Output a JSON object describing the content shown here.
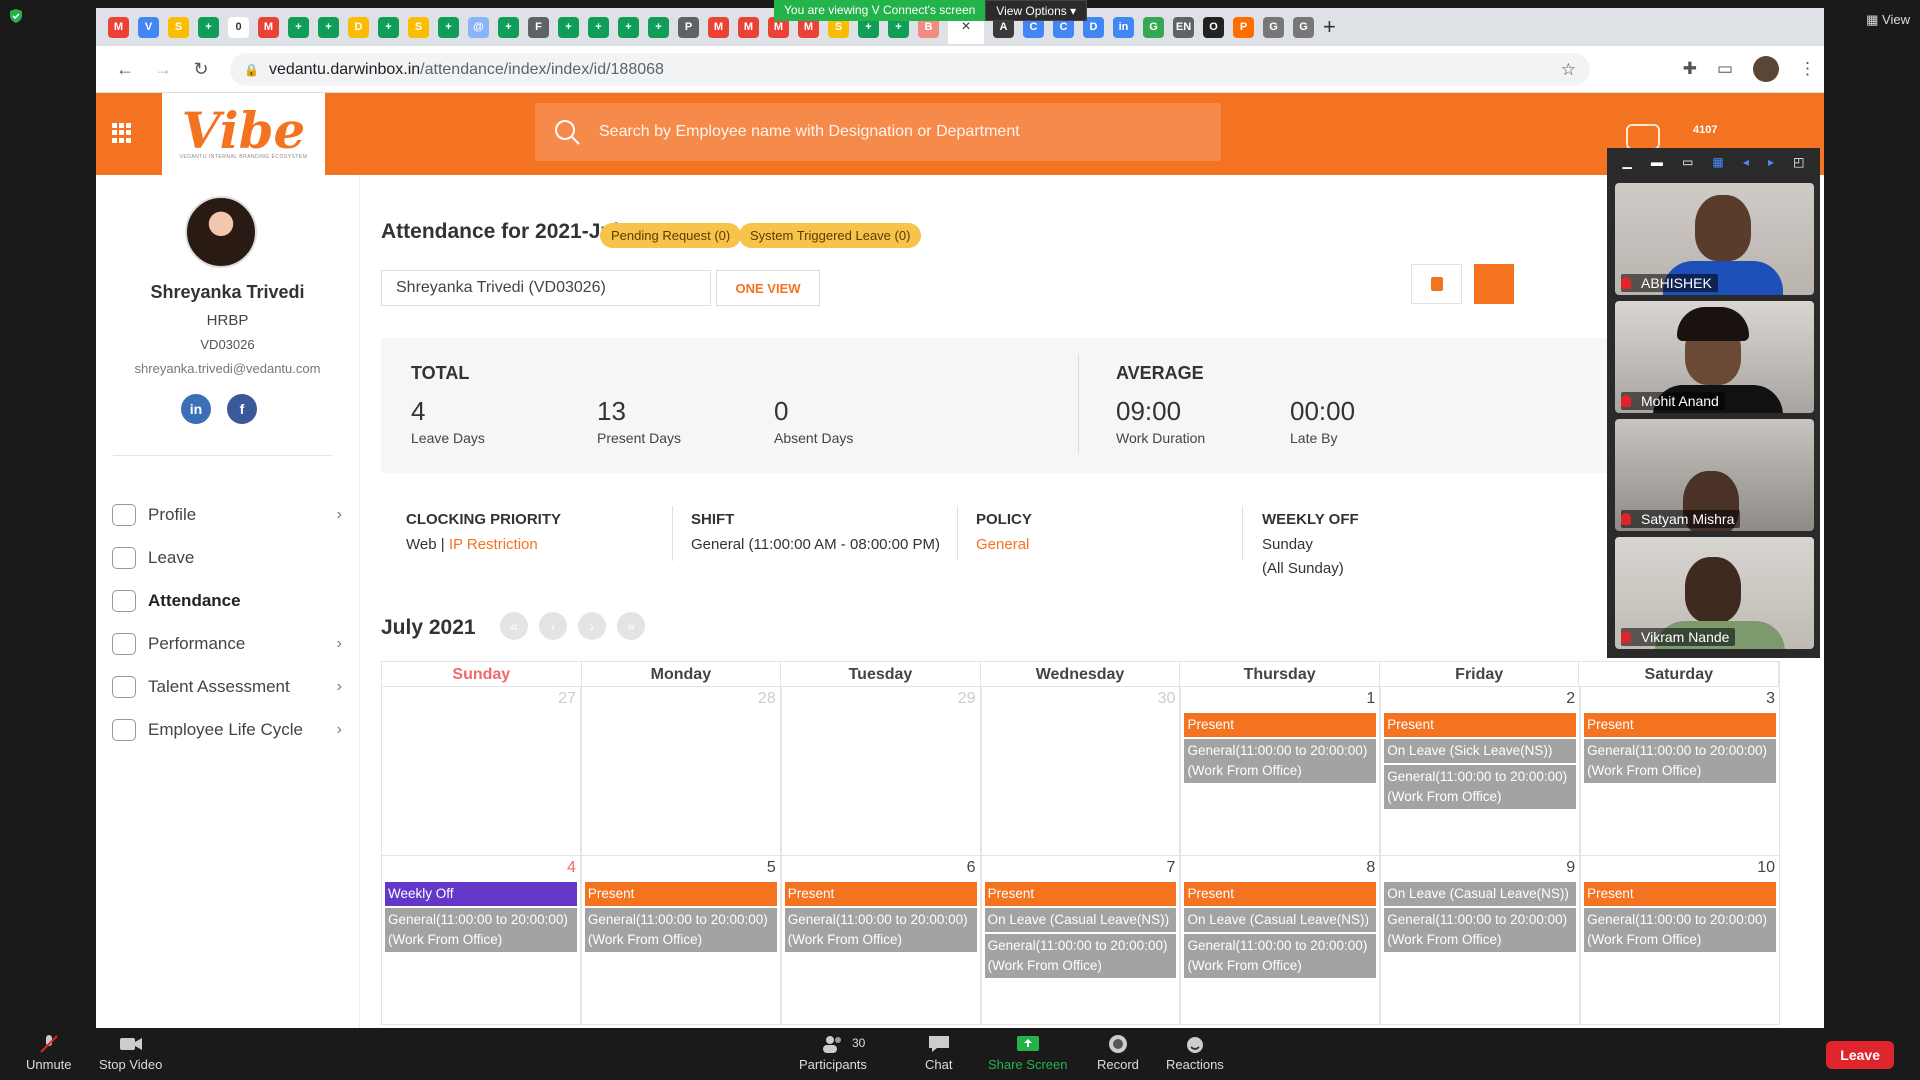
{
  "zoom": {
    "banner_text": "You are viewing V Connect's screen",
    "view_options": "View Options",
    "view_label": "View",
    "participants_count": "30",
    "toolbar": [
      {
        "label": "Unmute",
        "icon": "mic-muted-icon"
      },
      {
        "label": "Stop Video",
        "icon": "video-icon"
      },
      {
        "label": "Participants",
        "icon": "participants-icon"
      },
      {
        "label": "Chat",
        "icon": "chat-icon"
      },
      {
        "label": "Share Screen",
        "icon": "share-screen-icon"
      },
      {
        "label": "Record",
        "icon": "record-icon"
      },
      {
        "label": "Reactions",
        "icon": "reactions-icon"
      }
    ],
    "leave_label": "Leave",
    "participants": [
      "ABHISHEK",
      "Mohit Anand",
      "Satyam Mishra",
      "Vikram Nande"
    ]
  },
  "browser": {
    "url_host": "vedantu.darwinbox.in",
    "url_path": "/attendance/index/index/id/188068",
    "tab_icons": [
      "M",
      "V",
      "S",
      "+",
      "0",
      "M",
      "+",
      "+",
      "D",
      "+",
      "S",
      "+",
      "@",
      "+",
      "F",
      "+",
      "+",
      "+",
      "+",
      "P",
      "M",
      "M",
      "M",
      "M",
      "S",
      "+",
      "+",
      "B",
      "A",
      "C",
      "C",
      "D",
      "in",
      "G",
      "EN",
      "O",
      "P",
      "G",
      "G"
    ],
    "active_tab_close": "×",
    "new_tab": "+"
  },
  "app": {
    "logo_text": "Vibe",
    "logo_tagline": "VEDANTU INTERNAL BRANDING ECOSYSTEM",
    "search_placeholder": "Search by Employee name with Designation or Department",
    "notification_count": "4107"
  },
  "employee": {
    "name": "Shreyanka Trivedi",
    "role": "HRBP",
    "id": "VD03026",
    "email": "shreyanka.trivedi@vedantu.com"
  },
  "menu": [
    {
      "label": "Profile",
      "has_arrow": true,
      "active": false
    },
    {
      "label": "Leave",
      "has_arrow": false,
      "active": false
    },
    {
      "label": "Attendance",
      "has_arrow": false,
      "active": true
    },
    {
      "label": "Performance",
      "has_arrow": true,
      "active": false
    },
    {
      "label": "Talent Assessment",
      "has_arrow": true,
      "active": false
    },
    {
      "label": "Employee Life Cycle",
      "has_arrow": true,
      "active": false
    }
  ],
  "attendance": {
    "title": "Attendance for 2021-Jul",
    "pending_request": "Pending Request (0)",
    "system_leave": "System Triggered Leave (0)",
    "selected_employee": "Shreyanka Trivedi (VD03026)",
    "one_view": "ONE VIEW",
    "total_heading": "TOTAL",
    "average_heading": "AVERAGE",
    "stats": [
      {
        "value": "4",
        "label": "Leave Days"
      },
      {
        "value": "13",
        "label": "Present Days"
      },
      {
        "value": "0",
        "label": "Absent Days"
      },
      {
        "value": "09:00",
        "label": "Work Duration"
      },
      {
        "value": "00:00",
        "label": "Late By"
      }
    ],
    "clocking_priority": {
      "head": "CLOCKING PRIORITY",
      "value": "Web | ",
      "link": "IP Restriction"
    },
    "shift": {
      "head": "SHIFT",
      "value": "General (11:00:00 AM - 08:00:00 PM)"
    },
    "policy": {
      "head": "POLICY",
      "value": "General"
    },
    "weekly_off": {
      "head": "WEEKLY OFF",
      "value": "Sunday",
      "sub": "(All Sunday)"
    },
    "month_label": "July 2021"
  },
  "calendar": {
    "weekdays": [
      "Sunday",
      "Monday",
      "Tuesday",
      "Wednesday",
      "Thursday",
      "Friday",
      "Saturday"
    ],
    "weeks": [
      [
        {
          "day": "27",
          "muted": true,
          "events": []
        },
        {
          "day": "28",
          "muted": true,
          "events": []
        },
        {
          "day": "29",
          "muted": true,
          "events": []
        },
        {
          "day": "30",
          "muted": true,
          "events": []
        },
        {
          "day": "1",
          "events": [
            {
              "type": "present",
              "text": "Present"
            },
            {
              "type": "gray",
              "text": "General(11:00:00 to 20:00:00) (Work From Office)"
            }
          ]
        },
        {
          "day": "2",
          "events": [
            {
              "type": "present",
              "text": "Present"
            },
            {
              "type": "gray",
              "text": "On Leave (Sick Leave(NS))"
            },
            {
              "type": "gray",
              "text": "General(11:00:00 to 20:00:00) (Work From Office)"
            }
          ]
        },
        {
          "day": "3",
          "events": [
            {
              "type": "present",
              "text": "Present"
            },
            {
              "type": "gray",
              "text": "General(11:00:00 to 20:00:00) (Work From Office)"
            }
          ]
        }
      ],
      [
        {
          "day": "4",
          "sunday": true,
          "events": [
            {
              "type": "weekly",
              "text": "Weekly Off"
            },
            {
              "type": "gray",
              "text": "General(11:00:00 to 20:00:00) (Work From Office)"
            }
          ]
        },
        {
          "day": "5",
          "events": [
            {
              "type": "present",
              "text": "Present"
            },
            {
              "type": "gray",
              "text": "General(11:00:00 to 20:00:00) (Work From Office)"
            }
          ]
        },
        {
          "day": "6",
          "events": [
            {
              "type": "present",
              "text": "Present"
            },
            {
              "type": "gray",
              "text": "General(11:00:00 to 20:00:00) (Work From Office)"
            }
          ]
        },
        {
          "day": "7",
          "events": [
            {
              "type": "present",
              "text": "Present"
            },
            {
              "type": "gray",
              "text": "On Leave (Casual Leave(NS))"
            },
            {
              "type": "gray",
              "text": "General(11:00:00 to 20:00:00) (Work From Office)"
            }
          ]
        },
        {
          "day": "8",
          "events": [
            {
              "type": "present",
              "text": "Present"
            },
            {
              "type": "gray",
              "text": "On Leave (Casual Leave(NS))"
            },
            {
              "type": "gray",
              "text": "General(11:00:00 to 20:00:00) (Work From Office)"
            }
          ]
        },
        {
          "day": "9",
          "events": [
            {
              "type": "gray",
              "text": "On Leave (Casual Leave(NS))"
            },
            {
              "type": "gray",
              "text": "General(11:00:00 to 20:00:00) (Work From Office)"
            }
          ]
        },
        {
          "day": "10",
          "events": [
            {
              "type": "present",
              "text": "Present"
            },
            {
              "type": "gray",
              "text": "General(11:00:00 to 20:00:00) (Work From Office)"
            }
          ]
        }
      ]
    ]
  },
  "colors": {
    "brand": "#f47321",
    "weekly_off": "#6338c9",
    "pill": "#f8c34a",
    "event_gray": "#a3a3a3"
  }
}
